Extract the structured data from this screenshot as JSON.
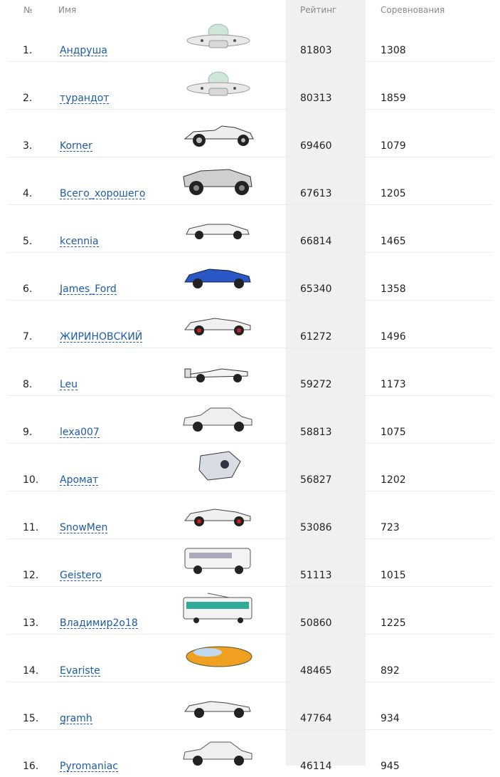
{
  "header": {
    "num": "№",
    "name": "Имя",
    "rating": "Рейтинг",
    "races": "Соревнования"
  },
  "rows": [
    {
      "num": "1.",
      "name": "Андруша",
      "rating": "81803",
      "races": "1308",
      "car": "ufo-icon"
    },
    {
      "num": "2.",
      "name": "турандот",
      "rating": "80313",
      "races": "1859",
      "car": "ufo-icon"
    },
    {
      "num": "3.",
      "name": "Korner",
      "rating": "69460",
      "races": "1079",
      "car": "hotrod-car-icon"
    },
    {
      "num": "4.",
      "name": "Всего_хорошего",
      "rating": "67613",
      "races": "1205",
      "car": "buggy-car-icon"
    },
    {
      "num": "5.",
      "name": "kcennia",
      "rating": "66814",
      "races": "1465",
      "car": "sports-car-icon"
    },
    {
      "num": "6.",
      "name": "James_Ford",
      "rating": "65340",
      "races": "1358",
      "car": "blue-sports-car-icon"
    },
    {
      "num": "7.",
      "name": "ЖИРИНОВСКИЙ",
      "rating": "61272",
      "races": "1496",
      "car": "supercar-icon"
    },
    {
      "num": "8.",
      "name": "Leu",
      "rating": "59272",
      "races": "1173",
      "car": "formula-car-icon"
    },
    {
      "num": "9.",
      "name": "lexa007",
      "rating": "58813",
      "races": "1075",
      "car": "sedan-car-icon"
    },
    {
      "num": "10.",
      "name": "Аромат",
      "rating": "56827",
      "races": "1202",
      "car": "spaceship-icon"
    },
    {
      "num": "11.",
      "name": "SnowMen",
      "rating": "53086",
      "races": "723",
      "car": "supercar-icon"
    },
    {
      "num": "12.",
      "name": "Geistero",
      "rating": "51113",
      "races": "1015",
      "car": "minibus-icon"
    },
    {
      "num": "13.",
      "name": "Владимир2o18",
      "rating": "50860",
      "races": "1225",
      "car": "tram-icon"
    },
    {
      "num": "14.",
      "name": "Evariste",
      "rating": "48465",
      "races": "892",
      "car": "hover-car-icon"
    },
    {
      "num": "15.",
      "name": "gramh",
      "rating": "47764",
      "races": "934",
      "car": "roadster-car-icon"
    },
    {
      "num": "16.",
      "name": "Pyromaniac",
      "rating": "46114",
      "races": "945",
      "car": "sedan-car-icon"
    }
  ]
}
